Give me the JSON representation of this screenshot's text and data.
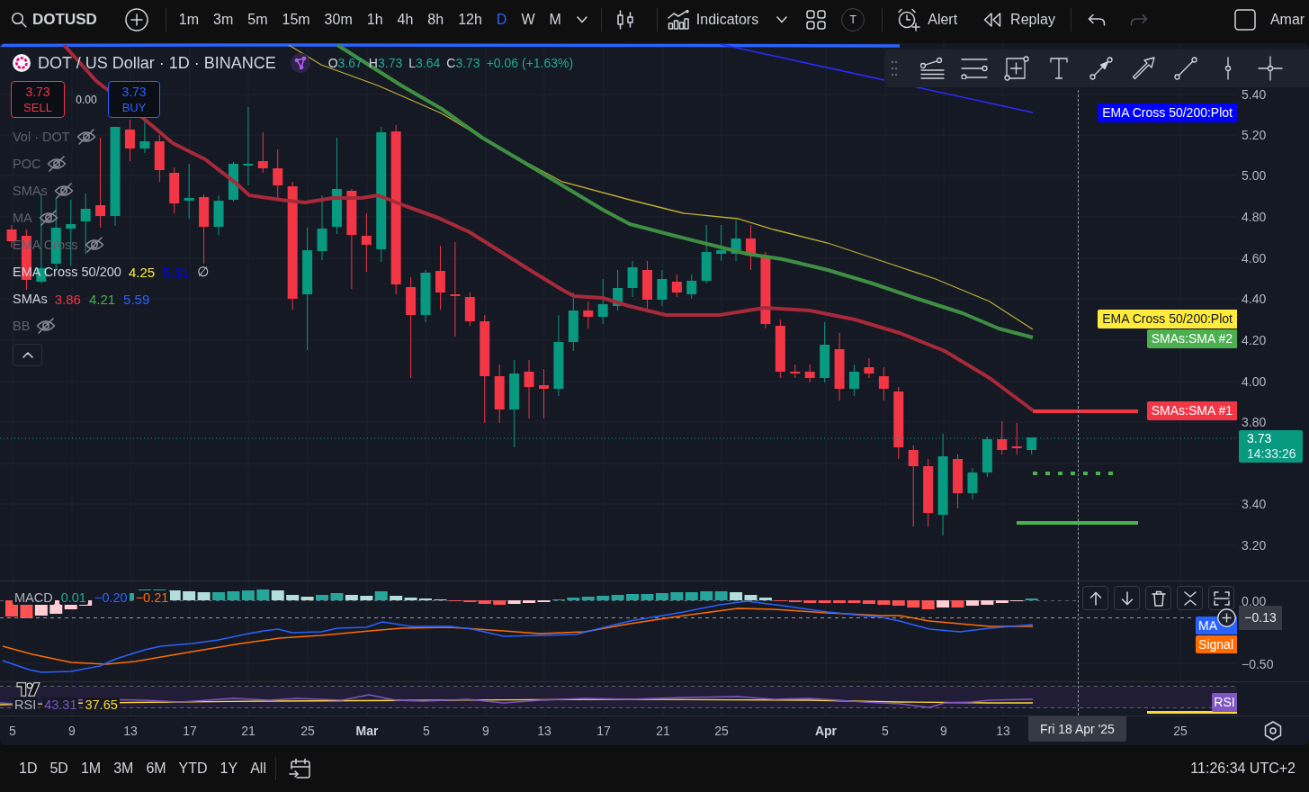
{
  "top_toolbar": {
    "symbol": "DOTUSD",
    "intervals": [
      {
        "label": "1m",
        "selected": false
      },
      {
        "label": "3m",
        "selected": false
      },
      {
        "label": "5m",
        "selected": false
      },
      {
        "label": "15m",
        "selected": false
      },
      {
        "label": "30m",
        "selected": false
      },
      {
        "label": "1h",
        "selected": false
      },
      {
        "label": "4h",
        "selected": false
      },
      {
        "label": "8h",
        "selected": false
      },
      {
        "label": "12h",
        "selected": false
      },
      {
        "label": "D",
        "selected": true
      },
      {
        "label": "W",
        "selected": false
      },
      {
        "label": "M",
        "selected": false
      }
    ],
    "indicators_button": "Indicators",
    "avatar_letter": "T",
    "alert_button": "Alert",
    "replay_button": "Replay",
    "redo_disabled": true,
    "account": "Amar"
  },
  "legend": {
    "title": "DOT / US Dollar · 1D · BINANCE",
    "ohlc": [
      {
        "label": "O",
        "value": "3.67"
      },
      {
        "label": "H",
        "value": "3.73"
      },
      {
        "label": "L",
        "value": "3.64"
      },
      {
        "label": "C",
        "value": "3.73"
      }
    ],
    "change": "+0.06 (+1.63%)",
    "trade": {
      "sell_price": "3.73",
      "sell_label": "SELL",
      "spread": "0.00",
      "buy_price": "3.73",
      "buy_label": "BUY"
    },
    "indicators": [
      {
        "name": "Vol · DOT",
        "hidden": true
      },
      {
        "name": "POC",
        "hidden": true
      },
      {
        "name": "SMAs",
        "hidden": true
      },
      {
        "name": "MA",
        "hidden": true
      },
      {
        "name": "EMA Cross",
        "hidden": true
      },
      {
        "name": "EMA Cross 50/200",
        "hidden": false,
        "values": [
          {
            "value": "4.25",
            "color": "#ffeb3b"
          },
          {
            "value": "5.31",
            "color": "#0000ff"
          },
          {
            "value": "∅",
            "color": "#d1d4dc"
          }
        ]
      },
      {
        "name": "SMAs",
        "hidden": false,
        "values": [
          {
            "value": "3.86",
            "color": "#f23645"
          },
          {
            "value": "4.21",
            "color": "#4caf50"
          },
          {
            "value": "5.59",
            "color": "#2962ff"
          }
        ]
      },
      {
        "name": "BB",
        "hidden": true
      }
    ]
  },
  "price_axis": {
    "ticks": [
      "5.40",
      "5.20",
      "5.00",
      "4.80",
      "4.60",
      "4.40",
      "4.20",
      "4.00",
      "3.80",
      "3.40",
      "3.20"
    ],
    "last_price": "3.73",
    "countdown": "14:33:26",
    "tags": [
      {
        "label": "EMA Cross 50/200:Plot",
        "color": "#0000ff"
      },
      {
        "label": "EMA Cross 50/200:Plot",
        "color": "#ffeb3b"
      },
      {
        "label": "SMAs:SMA #2",
        "color": "#4caf50"
      },
      {
        "label": "SMAs:SMA #1",
        "color": "#f23645"
      }
    ]
  },
  "macd_pane": {
    "name": "MACD",
    "values": [
      {
        "value": "0.01",
        "color": "#22ab94"
      },
      {
        "value": "−0.20",
        "color": "#2962ff"
      },
      {
        "value": "−0.21",
        "color": "#ff6d00"
      }
    ],
    "ticks": [
      "0.00",
      "−0.50"
    ],
    "crosshair_value": "−0.13",
    "tags": [
      {
        "label": "MA",
        "color": "#2962ff"
      },
      {
        "label": "Signal",
        "color": "#ff6d00"
      }
    ]
  },
  "rsi_pane": {
    "name": "RSI",
    "values": [
      {
        "value": "43.31",
        "color": "#7e57c2"
      },
      {
        "value": "37.65",
        "color": "#fdd835"
      }
    ],
    "tag": "RSI"
  },
  "time_axis": {
    "ticks": [
      {
        "label": "5",
        "kind": "day"
      },
      {
        "label": "9",
        "kind": "day"
      },
      {
        "label": "13",
        "kind": "day"
      },
      {
        "label": "17",
        "kind": "day"
      },
      {
        "label": "21",
        "kind": "day"
      },
      {
        "label": "25",
        "kind": "day"
      },
      {
        "label": "Mar",
        "kind": "month"
      },
      {
        "label": "5",
        "kind": "day"
      },
      {
        "label": "9",
        "kind": "day"
      },
      {
        "label": "13",
        "kind": "day"
      },
      {
        "label": "17",
        "kind": "day"
      },
      {
        "label": "21",
        "kind": "day"
      },
      {
        "label": "25",
        "kind": "day"
      },
      {
        "label": "Apr",
        "kind": "month"
      },
      {
        "label": "5",
        "kind": "day"
      },
      {
        "label": "9",
        "kind": "day"
      },
      {
        "label": "13",
        "kind": "day"
      },
      {
        "label": "25",
        "kind": "day"
      }
    ],
    "crosshair_label": "Fri 18 Apr '25"
  },
  "bottom_bar": {
    "ranges": [
      "1D",
      "5D",
      "1M",
      "3M",
      "6M",
      "YTD",
      "1Y",
      "All"
    ],
    "clock": "11:26:34 UTC+2"
  }
}
